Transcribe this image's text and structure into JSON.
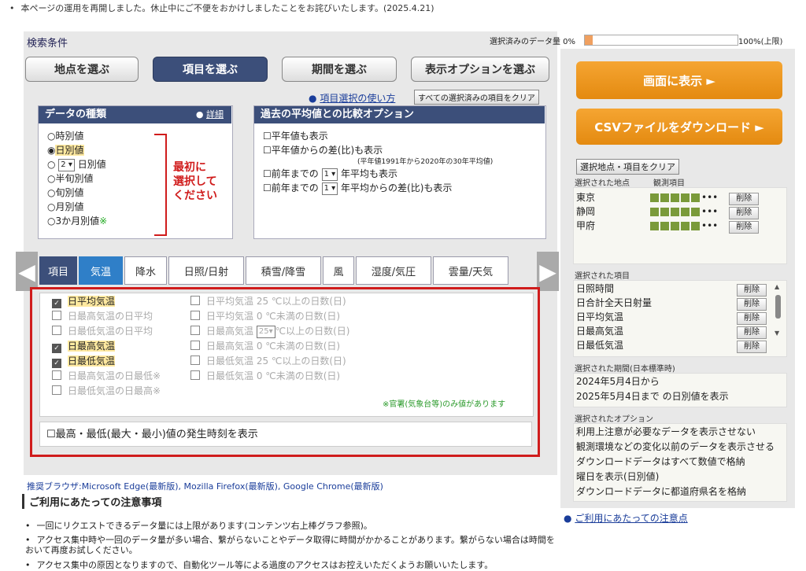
{
  "notice": "本ページの運用を再開しました。休止中にご不便をおかけしましたことをお詫びいたします。(2025.4.21)",
  "search": {
    "title": "検索条件",
    "data_amount_label": "選択済みのデータ量 0%",
    "progress": 0.05,
    "max_label": "100%(上限)"
  },
  "steps": [
    "地点を選ぶ",
    "項目を選ぶ",
    "期間を選ぶ",
    "表示オプションを選ぶ"
  ],
  "help_link": "項目選択の使い方",
  "clear_all": "すべての選択済みの項目をクリア",
  "data_type": {
    "title": "データの種類",
    "detail": "詳細",
    "options": [
      "時別値",
      "日別値",
      "日別値",
      "半旬別値",
      "旬別値",
      "月別値",
      "3か月別値"
    ],
    "n_value": "2",
    "instruction": [
      "最初に",
      "選択して",
      "ください"
    ]
  },
  "compare": {
    "title": "過去の平均値との比較オプション",
    "opt1": "平年値も表示",
    "opt2": "平年値からの差(比)も表示",
    "opt2_note": "(平年値1991年から2020年の30年平均値)",
    "opt3_a": "前年までの",
    "opt3_b": "年平均も表示",
    "opt4_a": "前年までの",
    "opt4_b": "年平均からの差(比)も表示",
    "n": "1"
  },
  "item_tab_label": "項目",
  "categories": [
    "気温",
    "降水",
    "日照/日射",
    "積雪/降雪",
    "風",
    "湿度/気圧",
    "雲量/天気"
  ],
  "temp_items_left": [
    "日平均気温",
    "日最高気温の日平均",
    "日最低気温の日平均",
    "日最高気温",
    "日最低気温",
    "日最高気温の日最低※",
    "日最低気温の日最高※"
  ],
  "temp_items_right": [
    "日平均気温 25 ℃以上の日数(日)",
    "日平均気温 0 ℃未満の日数(日)",
    "日最高気温",
    "℃以上の日数(日)",
    "日最高気温 0 ℃未満の日数(日)",
    "日最低気温 25 ℃以上の日数(日)",
    "日最低気温 0 ℃未満の日数(日)"
  ],
  "temp_threshold": "25",
  "official_note": "※官署(気象台等)のみ値があります",
  "extreme_time": "最高・最低(最大・最小)値の発生時刻を表示",
  "browser": "推奨ブラウザ:Microsoft Edge(最新版), Mozilla Firefox(最新版), Google Chrome(最新版)",
  "notes_title": "ご利用にあたっての注意事項",
  "notes": [
    "一回にリクエストできるデータ量には上限があります(コンテンツ右上棒グラフ参照)。",
    "アクセス集中時や一回のデータ量が多い場合、繋がらないことやデータ取得に時間がかかることがあります。繋がらない場合は時間をおいて再度お試しください。",
    "アクセス集中の原因となりますので、自動化ツール等による過度のアクセスはお控えいただくようお願いいたします。"
  ],
  "right": {
    "show": "画面に表示 ►",
    "csv": "CSVファイルをダウンロード ►",
    "clear": "選択地点・項目をクリア",
    "stations_label": "選択された地点",
    "items_col_label": "観測項目",
    "stations": [
      "東京",
      "静岡",
      "甲府"
    ],
    "delete": "削除",
    "items_label": "選択された項目",
    "items": [
      "日照時間",
      "日合計全天日射量",
      "日平均気温",
      "日最高気温",
      "日最低気温"
    ],
    "period_label": "選択された期間(日本標準時)",
    "period": [
      "2024年5月4日から",
      "2025年5月4日まで の日別値を表示"
    ],
    "options_label": "選択されたオプション",
    "options": [
      "利用上注意が必要なデータを表示させない",
      "観測環境などの変化以前のデータを表示させる",
      "ダウンロードデータはすべて数値で格納",
      "曜日を表示(日別値)",
      "ダウンロードデータに都道府県名を格納"
    ],
    "notice_link": "ご利用にあたっての注意点"
  }
}
